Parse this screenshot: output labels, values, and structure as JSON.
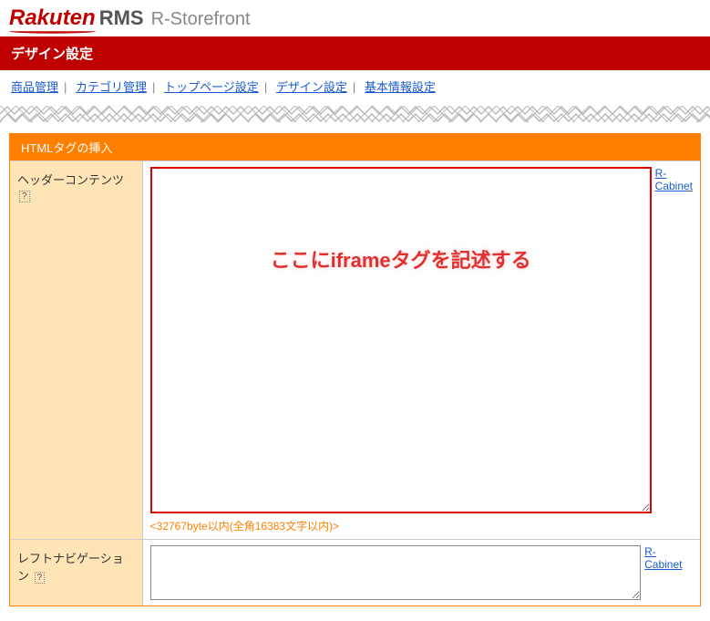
{
  "header": {
    "logo": "Rakuten",
    "logo_rms": "RMS",
    "subtitle": "R-Storefront"
  },
  "title_bar": "デザイン設定",
  "nav": {
    "items": [
      "商品管理",
      "カテゴリ管理",
      "トップページ設定",
      "デザイン設定",
      "基本情報設定"
    ]
  },
  "panel": {
    "header": "HTMLタグの挿入",
    "rows": [
      {
        "label": "ヘッダーコンテンツ",
        "help": "?",
        "rcabinet": "R-Cabinet",
        "overlay": "ここにiframeタグを記述する",
        "byte_note": "<32767byte以内(全角16383文字以内)>"
      },
      {
        "label": "レフトナビゲーション",
        "help": "?",
        "rcabinet": "R-Cabinet"
      }
    ]
  }
}
